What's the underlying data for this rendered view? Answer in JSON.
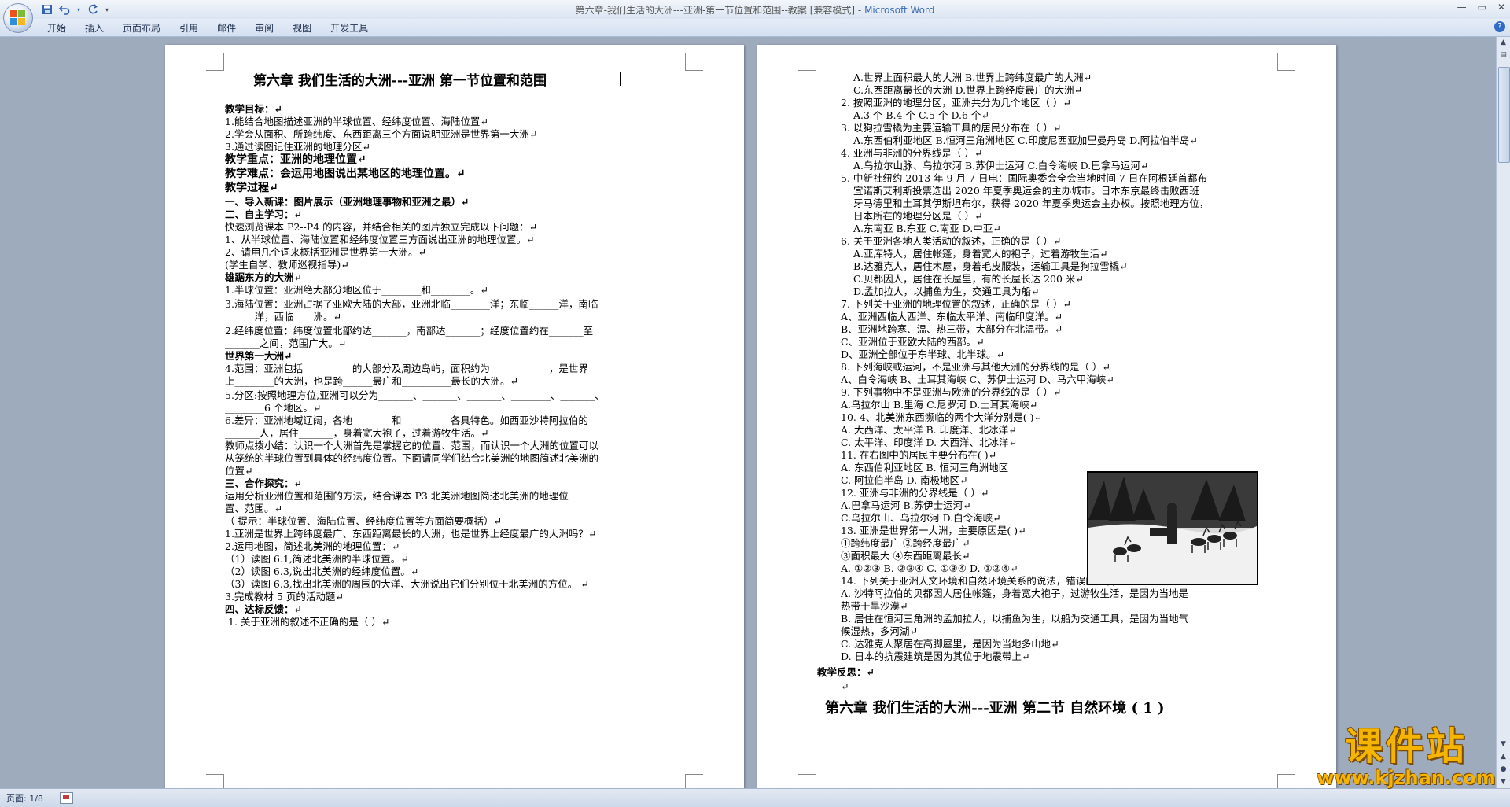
{
  "window": {
    "title_doc": "第六章-我们生活的大洲---亚洲-第一节位置和范围--教案 [兼容模式] - ",
    "title_app": "Microsoft Word"
  },
  "ribbon": {
    "tabs": [
      "开始",
      "插入",
      "页面布局",
      "引用",
      "邮件",
      "审阅",
      "视图",
      "开发工具"
    ]
  },
  "status": {
    "pages": "页面: 1/8"
  },
  "watermark": {
    "text": "课件站",
    "url": "www.kjzhan.com"
  },
  "left_page": [
    {
      "t": "第六章  我们生活的大洲---亚洲  第一节位置和范围 ",
      "s": "h"
    },
    {
      "t": "教学目标：↵",
      "s": "b"
    },
    {
      "t": "1.能结合地图描述亚洲的半球位置、经纬度位置、海陆位置↵",
      "s": ""
    },
    {
      "t": "2.学会从面积、所跨纬度、东西距离三个方面说明亚洲是世界第一大洲↵",
      "s": ""
    },
    {
      "t": "3.通过读图记住亚洲的地理分区↵",
      "s": ""
    },
    {
      "t": "教学重点：亚洲的地理位置↵",
      "s": "h2"
    },
    {
      "t": "教学难点：会运用地图说出某地区的地理位置。↵",
      "s": "h2"
    },
    {
      "t": "教学过程↵",
      "s": "h2"
    },
    {
      "t": "一、导入新课：图片展示（亚洲地理事物和亚洲之最）↵",
      "s": "b"
    },
    {
      "t": "二、自主学习：↵",
      "s": "b"
    },
    {
      "t": "快速浏览课本 P2--P4 的内容，并结合相关的图片独立完成以下问题：↵",
      "s": ""
    },
    {
      "t": "1、从半球位置、海陆位置和经纬度位置三方面说出亚洲的地理位置。↵",
      "s": ""
    },
    {
      "t": "2、请用几个词来概括亚洲是世界第一大洲。↵",
      "s": ""
    },
    {
      "t": " (学生自学、教师巡视指导)↵",
      "s": ""
    },
    {
      "t": "雄踞东方的大洲↵",
      "s": "b"
    },
    {
      "t": "1.半球位置：亚洲绝大部分地区位于________和________。↵",
      "s": ""
    },
    {
      "t": "3.海陆位置：亚洲占据了亚欧大陆的大部，亚洲北临________洋；东临______洋，南临",
      "s": ""
    },
    {
      "t": "______洋，西临____洲。↵",
      "s": ""
    },
    {
      "t": "2.经纬度位置：纬度位置北部约达_______，南部达_______；经度位置约在_______至",
      "s": ""
    },
    {
      "t": "_______之间，范围广大。↵",
      "s": ""
    },
    {
      "t": "世界第一大洲↵",
      "s": "b"
    },
    {
      "t": "4.范围：亚洲包括__________的大部分及周边岛屿，面积约为____________，是世界",
      "s": ""
    },
    {
      "t": "上________的大洲，也是跨______最广和__________最长的大洲。↵",
      "s": ""
    },
    {
      "t": "5.分区:按照地理方位,亚洲可以分为_______、_______、_______、________、_______、",
      "s": ""
    },
    {
      "t": "________6 个地区。↵",
      "s": ""
    },
    {
      "t": "6.差异：亚洲地域辽阔，各地________和__________各具特色。如西亚沙特阿拉伯的",
      "s": ""
    },
    {
      "t": "_______人，居住_______，身着宽大袍子，过着游牧生活。↵",
      "s": ""
    },
    {
      "t": "教师点拨小结：认识一个大洲首先是掌握它的位置、范围，而认识一个大洲的位置可以",
      "s": ""
    },
    {
      "t": "从笼统的半球位置到具体的经纬度位置。下面请同学们结合北美洲的地图简述北美洲的",
      "s": ""
    },
    {
      "t": "位置↵",
      "s": ""
    },
    {
      "t": "三、合作探究：↵",
      "s": "b"
    },
    {
      "t": "        运用分析亚洲位置和范围的方法，结合课本 P3 北美洲地图简述北美洲的地理位",
      "s": ""
    },
    {
      "t": "置、范围。↵",
      "s": ""
    },
    {
      "t": "    （ 提示：半球位置、海陆位置、经纬度位置等方面简要概括）↵",
      "s": ""
    },
    {
      "t": "1.亚洲是世界上跨纬度最广、东西距离最长的大洲，也是世界上经度最广的大洲吗？↵",
      "s": ""
    },
    {
      "t": "2.运用地图，简述北美洲的地理位置：↵",
      "s": ""
    },
    {
      "t": "（1）读图 6.1,简述北美洲的半球位置。↵",
      "s": ""
    },
    {
      "t": "（2）读图 6.3,说出北美洲的经纬度位置。↵",
      "s": ""
    },
    {
      "t": "（3）读图 6.3,找出北美洲的周围的大洋、大洲说出它们分别位于北美洲的方位。  ↵",
      "s": ""
    },
    {
      "t": "3.完成教材 5 页的活动题↵",
      "s": ""
    },
    {
      "t": "四、达标反馈：↵",
      "s": "b"
    },
    {
      "t": "    1. 关于亚洲的叙述不正确的是（        ）↵",
      "s": ""
    }
  ],
  "right_page": [
    {
      "t": "A.世界上面积最大的大洲         B.世界上跨纬度最广的大洲↵",
      "s": ""
    },
    {
      "t": "C.东西距离最长的大洲          D.世界上跨经度最广的大洲↵",
      "s": ""
    },
    {
      "t": "2. 按照亚洲的地理分区，亚洲共分为几个地区（        ）↵",
      "s": ""
    },
    {
      "t": "A.3 个                B.4 个            C.5 个          D.6 个↵",
      "s": ""
    },
    {
      "t": "3. 以狗拉雪橇为主要运输工具的居民分布在（        ）↵",
      "s": ""
    },
    {
      "t": "A.东西伯利亚地区 B.恒河三角洲地区 C.印度尼西亚加里曼丹岛 D.阿拉伯半岛↵",
      "s": ""
    },
    {
      "t": "4. 亚洲与非洲的分界线是（        ）↵",
      "s": ""
    },
    {
      "t": "A.乌拉尔山脉、乌拉尔河         B.苏伊士运河       C.白令海峡      D.巴拿马运河↵",
      "s": ""
    },
    {
      "t": "5. 中新社纽约 2013 年 9 月 7 日电：国际奥委会全会当地时间 7 日在阿根廷首都布",
      "s": ""
    },
    {
      "t": "宜诺斯艾利斯投票选出 2020 年夏季奥运会的主办城市。日本东京最终击败西班",
      "s": ""
    },
    {
      "t": "牙马德里和土耳其伊斯坦布尔，获得 2020 年夏季奥运会主办权。按照地理方位，",
      "s": ""
    },
    {
      "t": "日本所在的地理分区是（        ）↵",
      "s": ""
    },
    {
      "t": "A.东南亚               B.东亚        C.南亚                   D.中亚↵",
      "s": ""
    },
    {
      "t": "6. 关于亚洲各地人类活动的叙述，正确的是（        ）↵",
      "s": ""
    },
    {
      "t": "A.亚库特人，居住帐篷，身着宽大的袍子，过着游牧生活↵",
      "s": ""
    },
    {
      "t": "B.达雅克人，居住木屋，身着毛皮服装，运输工具是狗拉雪橇↵",
      "s": ""
    },
    {
      "t": "C.贝都因人，居住在长屋里，有的长屋长达 200 米↵",
      "s": ""
    },
    {
      "t": "D.孟加拉人，以捕鱼为生，交通工具为船↵",
      "s": ""
    },
    {
      "t": "7. 下列关于亚洲的地理位置的叙述，正确的是（        ）↵",
      "s": ""
    },
    {
      "t": "  A、亚洲西临大西洋、东临太平洋、南临印度洋。↵",
      "s": ""
    },
    {
      "t": "  B、亚洲地跨寒、温、热三带，大部分在北温带。↵",
      "s": ""
    },
    {
      "t": "  C、亚洲位于亚欧大陆的西部。↵",
      "s": ""
    },
    {
      "t": "  D、亚洲全部位于东半球、北半球。↵",
      "s": ""
    },
    {
      "t": "8. 下列海峡或运河，不是亚洲与其他大洲的分界线的是（        ）↵",
      "s": ""
    },
    {
      "t": "  A、白令海峡         B、土耳其海峡          C、苏伊士运河          D、马六甲海峡↵",
      "s": ""
    },
    {
      "t": "9. 下列事物中不是亚洲与欧洲的分界线的是（        ）↵",
      "s": ""
    },
    {
      "t": "  A.乌拉尔山          B.里海         C.尼罗河          D.土耳其海峡↵",
      "s": ""
    },
    {
      "t": "10. 4、北美洲东西濒临的两个大洋分别是(          )↵",
      "s": ""
    },
    {
      "t": "  A. 大西洋、太平洋  B. 印度洋、北冰洋↵",
      "s": ""
    },
    {
      "t": "  C. 太平洋、印度洋  D. 大西洋、北冰洋↵",
      "s": ""
    },
    {
      "t": "11. 在右图中的居民主要分布在(        )↵",
      "s": ""
    },
    {
      "t": "  A. 东西伯利亚地区     B. 恒河三角洲地区",
      "s": ""
    },
    {
      "t": "  C. 阿拉伯半岛          D. 南极地区↵",
      "s": ""
    },
    {
      "t": "12. 亚洲与非洲的分界线是（      ）↵",
      "s": ""
    },
    {
      "t": "  A.巴拿马运河               B.苏伊士运河↵",
      "s": ""
    },
    {
      "t": "    C.乌拉尔山、乌拉尔河   D.白令海峡↵",
      "s": ""
    },
    {
      "t": "13. 亚洲是世界第一大洲，主要原因是(        )↵",
      "s": ""
    },
    {
      "t": "  ①跨纬度最广          ②跨经度最广↵",
      "s": ""
    },
    {
      "t": "  ③面积最大              ④东西距离最长↵",
      "s": ""
    },
    {
      "t": "  A. ①②③  B. ②③④  C. ①③④  D. ①②④↵",
      "s": ""
    },
    {
      "t": "14. 下列关于亚洲人文环境和自然环境关系的说法，错误的是(        )↵",
      "s": ""
    },
    {
      "t": "A. 沙特阿拉伯的贝都因人居住帐篷，身着宽大袍子，过游牧生活，是因为当地是",
      "s": ""
    },
    {
      "t": "  热带干旱沙漠↵",
      "s": ""
    },
    {
      "t": "B. 居住在恒河三角洲的孟加拉人，以捕鱼为生，以船为交通工具，是因为当地气",
      "s": ""
    },
    {
      "t": "  候湿热，多河湖↵",
      "s": ""
    },
    {
      "t": "C. 达雅克人聚居在高脚屋里，是因为当地多山地↵",
      "s": ""
    },
    {
      "t": "D. 日本的抗震建筑是因为其位于地震带上↵",
      "s": ""
    },
    {
      "t": "教学反思：↵",
      "s": "b"
    },
    {
      "t": "↵",
      "s": ""
    },
    {
      "t": "第六章  我们生活的大洲---亚洲  第二节  自然环境 ( 1 )",
      "s": "head"
    }
  ]
}
